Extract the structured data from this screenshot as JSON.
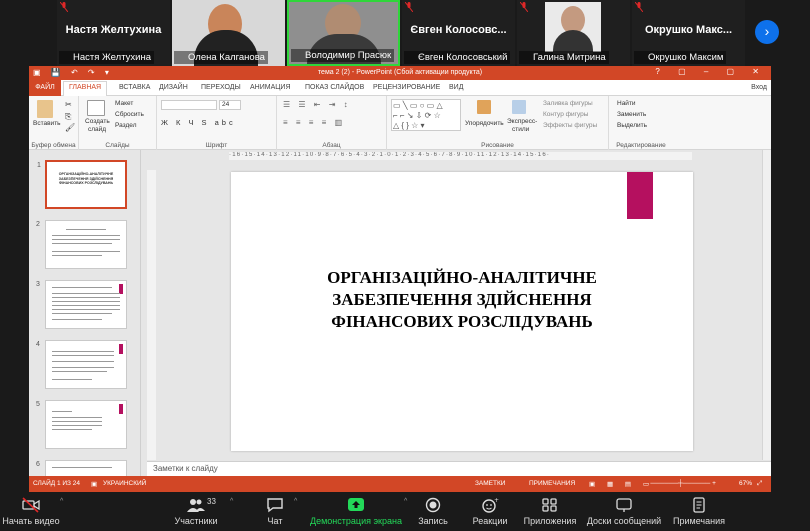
{
  "gallery": {
    "tiles": [
      {
        "big": "Настя Желтухина",
        "name": "Настя Желтухина"
      },
      {
        "name": "Олена Калганова"
      },
      {
        "name": "Володимир Прасюк"
      },
      {
        "big": "Євген  Колосовс...",
        "name": "Євген Колосовський"
      },
      {
        "name": "Галина Митрина"
      },
      {
        "big": "Окрушко  Макс...",
        "name": "Окрушко Максим"
      }
    ]
  },
  "powerpoint": {
    "window_title": "тема 2 (2) - PowerPoint (Сбой активации продукта)",
    "sign_in": "Вход",
    "tabs": [
      "ФАЙЛ",
      "ГЛАВНАЯ",
      "ВСТАВКА",
      "ДИЗАЙН",
      "ПЕРЕХОДЫ",
      "АНИМАЦИЯ",
      "ПОКАЗ СЛАЙДОВ",
      "РЕЦЕНЗИРОВАНИЕ",
      "ВИД"
    ],
    "ribbon": {
      "paste": "Вставить",
      "clipboard": "Буфер обмена",
      "create_slide_1": "Создать",
      "create_slide_2": "слайд",
      "layout": "Макет",
      "reset": "Сбросить",
      "section": "Раздел",
      "slides": "Слайды",
      "font_size": "24",
      "font": "Шрифт",
      "paragraph": "Абзац",
      "arrange": "Упорядочить",
      "quick_styles_1": "Экспресс-",
      "quick_styles_2": "стили",
      "shape_fill": "Заливка фигуры",
      "shape_outline": "Контур фигуры",
      "shape_effects": "Эффекты фигуры",
      "drawing": "Рисование",
      "find": "Найти",
      "replace": "Заменить",
      "select": "Выделить",
      "editing": "Редактирование"
    },
    "ruler_h": "·16·15·14·13·12·11·10·9·8·7·6·5·4·3·2·1·0·1·2·3·4·5·6·7·8·9·10·11·12·13·14·15·16·",
    "thumbnails": [
      {
        "num": "1",
        "text": "ОРГАНІЗАЦІЙНО-АНАЛІТИЧНЕ ЗАБЕЗПЕЧЕННЯ ЗДІЙСНЕННЯ ФІНАНСОВИХ РОЗСЛІДУВАНЬ"
      },
      {
        "num": "2"
      },
      {
        "num": "3"
      },
      {
        "num": "4"
      },
      {
        "num": "5"
      },
      {
        "num": "6"
      }
    ],
    "slide_title": [
      "ОРГАНІЗАЦІЙНО-АНАЛІТИЧНЕ",
      "ЗАБЕЗПЕЧЕННЯ ЗДІЙСНЕННЯ",
      "ФІНАНСОВИХ РОЗСЛІДУВАНЬ"
    ],
    "notes_placeholder": "Заметки к слайду",
    "status": {
      "slide_info": "СЛАЙД 1 ИЗ 24",
      "language": "УКРАИНСКИЙ",
      "notes": "ЗАМЕТКИ",
      "comments": "ПРИМЕЧАНИЯ",
      "zoom": "67%"
    }
  },
  "toolbar": {
    "stop_video": "Начать видео",
    "participants": "Участники",
    "participants_count": "33",
    "chat": "Чат",
    "share": "Демонстрация экрана",
    "record": "Запись",
    "reactions": "Реакции",
    "apps": "Приложения",
    "whiteboards": "Доски сообщений",
    "notes": "Примечания"
  },
  "colors": {
    "accent": "#d24726",
    "brand_pink": "#b5105f",
    "zoom_green": "#23d959"
  }
}
